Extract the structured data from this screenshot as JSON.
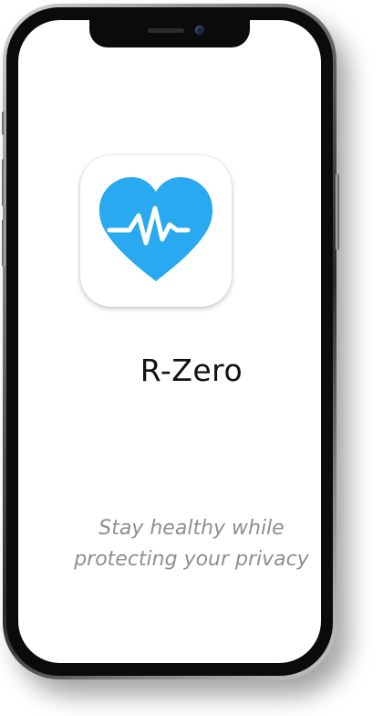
{
  "app": {
    "name": "R-Zero",
    "tagline_line1": "Stay healthy while",
    "tagline_line2": "protecting your privacy",
    "icon": "heart-pulse-icon"
  },
  "colors": {
    "accent": "#29A9F0",
    "pulse_line": "#FFFFFF",
    "app_name_text": "#111111",
    "tagline_text": "#8F8F8F",
    "background": "#FFFFFF"
  }
}
